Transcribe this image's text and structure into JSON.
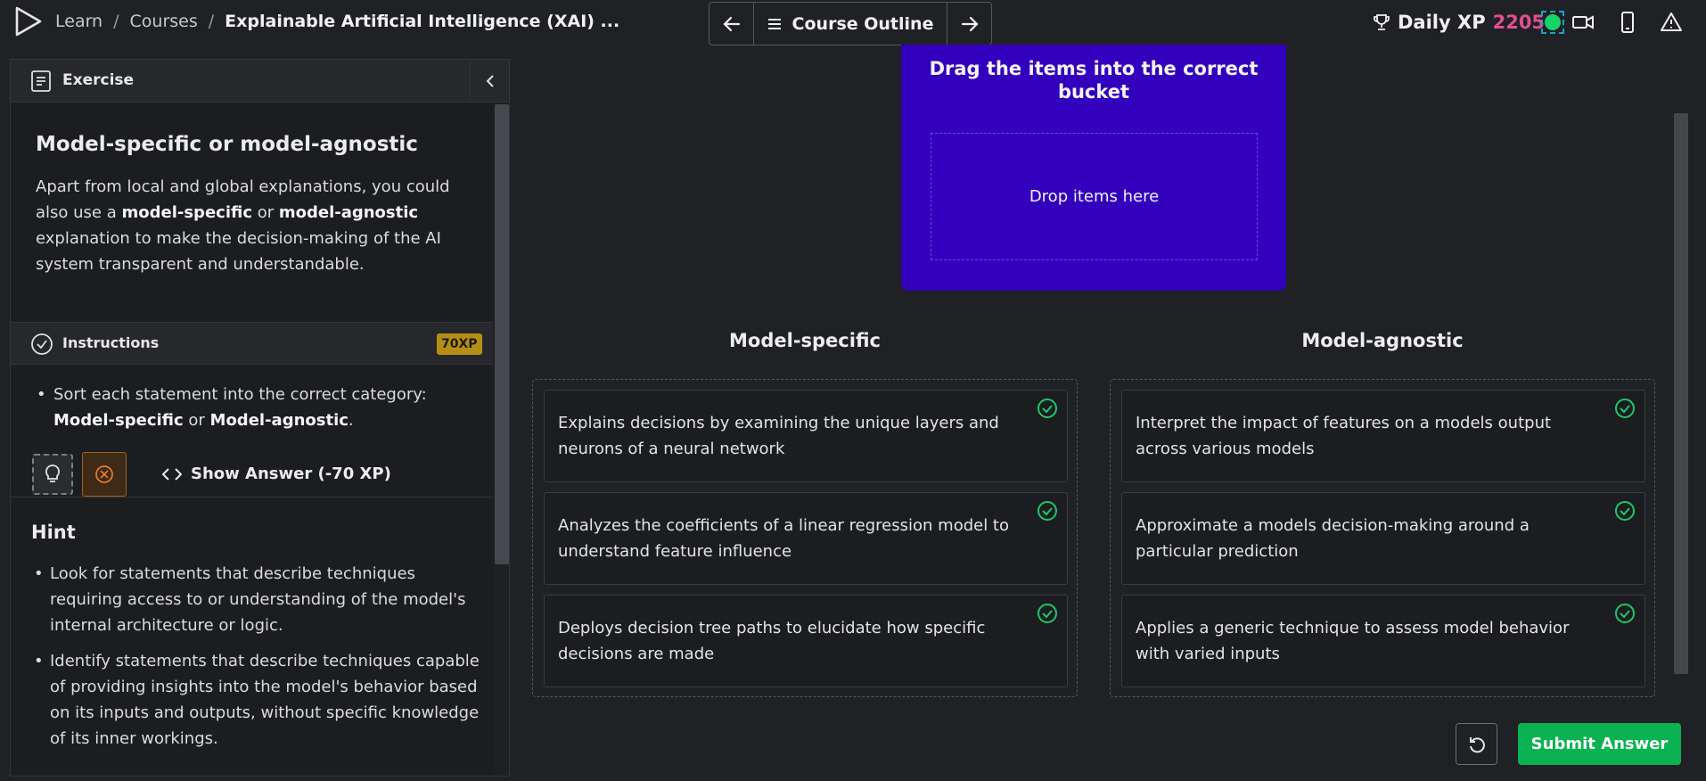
{
  "header": {
    "breadcrumb": [
      "Learn",
      "Courses",
      "Explainable Artificial Intelligence (XAI) ..."
    ],
    "nav": {
      "prev_icon": "arrow-left-icon",
      "outline_label": "Course Outline",
      "next_icon": "arrow-right-icon"
    },
    "xp_label": "Daily XP",
    "xp_value": "2205",
    "icons": [
      "trophy-icon",
      "video-icon",
      "mobile-icon",
      "alert-icon"
    ],
    "status_color": "#17d16b"
  },
  "exercise": {
    "header_label": "Exercise",
    "title": "Model-specific or model-agnostic",
    "body_parts": [
      "Apart from local and global explanations, you could also use a ",
      "model-specific",
      " or ",
      "model-agnostic",
      " explanation to make the decision-making of the AI system transparent and understandable."
    ]
  },
  "instructions": {
    "header_label": "Instructions",
    "xp_badge": "70XP",
    "item_parts": [
      "Sort each statement into the correct category: ",
      "Model-specific",
      " or ",
      "Model-agnostic",
      "."
    ],
    "show_answer_label": "Show Answer (-70 XP)"
  },
  "hint": {
    "title": "Hint",
    "items": [
      "Look for statements that describe techniques requiring access to or understanding of the model's internal architecture or logic.",
      "Identify statements that describe techniques capable of providing insights into the model's behavior based on its inputs and outputs, without specific knowledge of its inner workings."
    ]
  },
  "drag_source": {
    "title": "Drag the items into the correct bucket",
    "drop_placeholder": "Drop items here",
    "color": "#3300bd"
  },
  "buckets": [
    {
      "title": "Model-specific",
      "cards": [
        "Explains decisions by examining the unique layers and neurons of a neural network",
        "Analyzes the coefficients of a linear regression model to understand feature influence",
        "Deploys decision tree paths to elucidate how specific decisions are made"
      ]
    },
    {
      "title": "Model-agnostic",
      "cards": [
        "Interpret the impact of features on a models output across various models",
        "Approximate a models decision-making around a particular prediction",
        "Applies a generic technique to assess model behavior with varied inputs"
      ]
    }
  ],
  "actions": {
    "reset_icon": "reset-icon",
    "submit_label": "Submit Answer",
    "submit_color": "#0bb251"
  }
}
